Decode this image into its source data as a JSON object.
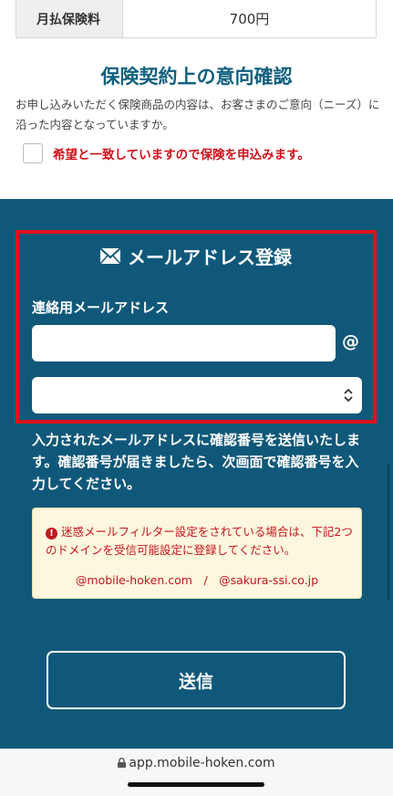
{
  "premium": {
    "label": "月払保険料",
    "value": "700円"
  },
  "intent": {
    "title": "保険契約上の意向確認",
    "description": "お申し込みいただく保険商品の内容は、お客さまのご意向（ニーズ）に沿った内容となっていますか。",
    "confirm_label": "希望と一致していますので保険を申込みます。"
  },
  "email": {
    "heading": "メールアドレス登録",
    "field_label": "連絡用メールアドレス",
    "local_value": "",
    "at_sign": "@",
    "domain_value": "",
    "info_text": "入力されたメールアドレスに確認番号を送信いたします。確認番号が届きましたら、次画面で確認番号を入力してください。"
  },
  "warning": {
    "icon": "exclamation-icon",
    "text": "迷惑メールフィルター設定をされている場合は、下記2つのドメインを受信可能設定に登録してください。",
    "domains": "@mobile-hoken.com　/　@sakura-ssi.co.jp"
  },
  "submit_label": "送信",
  "browser": {
    "url": "app.mobile-hoken.com"
  },
  "colors": {
    "section_blue": "#10587a",
    "title_blue": "#11607f",
    "alert_red": "#d0121b",
    "warning_bg": "#fdf7dd"
  }
}
